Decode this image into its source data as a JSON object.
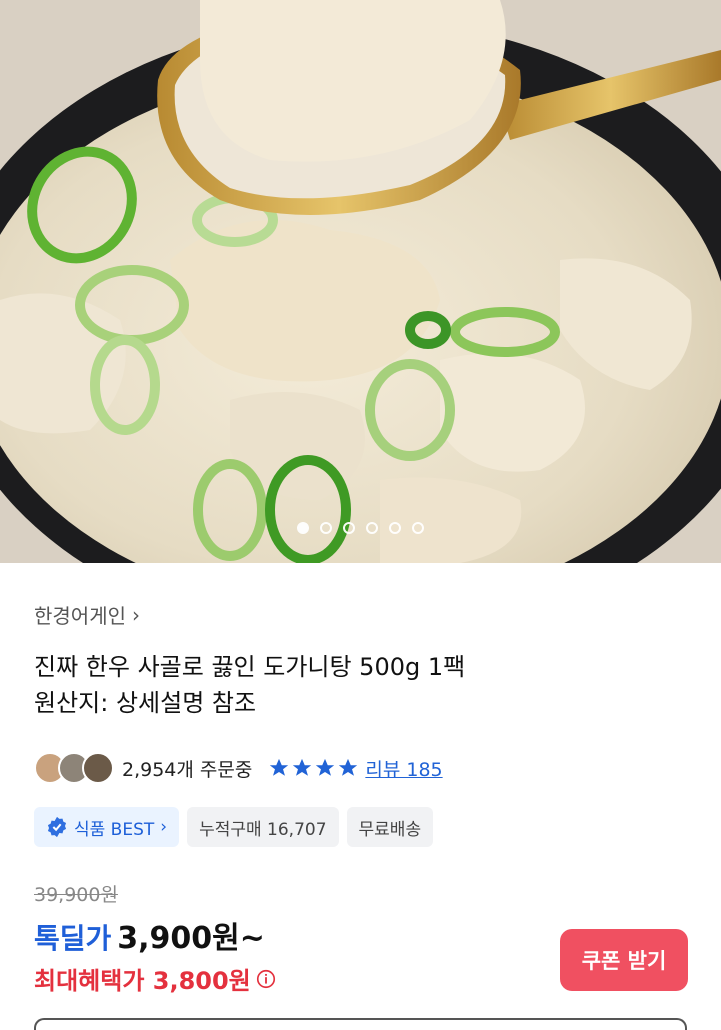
{
  "gallery": {
    "slide_count": 6,
    "active_index": 0
  },
  "seller": {
    "name": "한경어게인",
    "chevron": "›"
  },
  "product": {
    "title_line1": "진짜 한우 사골로 끓인 도가니탕 500g 1팩",
    "title_line2": "원산지: 상세설명 참조"
  },
  "stats": {
    "orders": "2,954개 주문중",
    "rating_stars": 4,
    "review_label": "리뷰 185"
  },
  "badges": [
    {
      "label": "식품 BEST",
      "icon": "certified-badge-icon",
      "chevron": "›"
    },
    {
      "label": "누적구매 16,707"
    },
    {
      "label": "무료배송"
    }
  ],
  "price": {
    "original": "39,900원",
    "deal_label": "톡딜가",
    "deal_price": "3,900원~",
    "benefit": "최대혜택가 3,800원"
  },
  "coupon_button": "쿠폰 받기",
  "colors": {
    "accent_blue": "#1f5fd8",
    "accent_red": "#e4313e",
    "coupon_bg": "#f05061",
    "star": "#2163d6"
  }
}
